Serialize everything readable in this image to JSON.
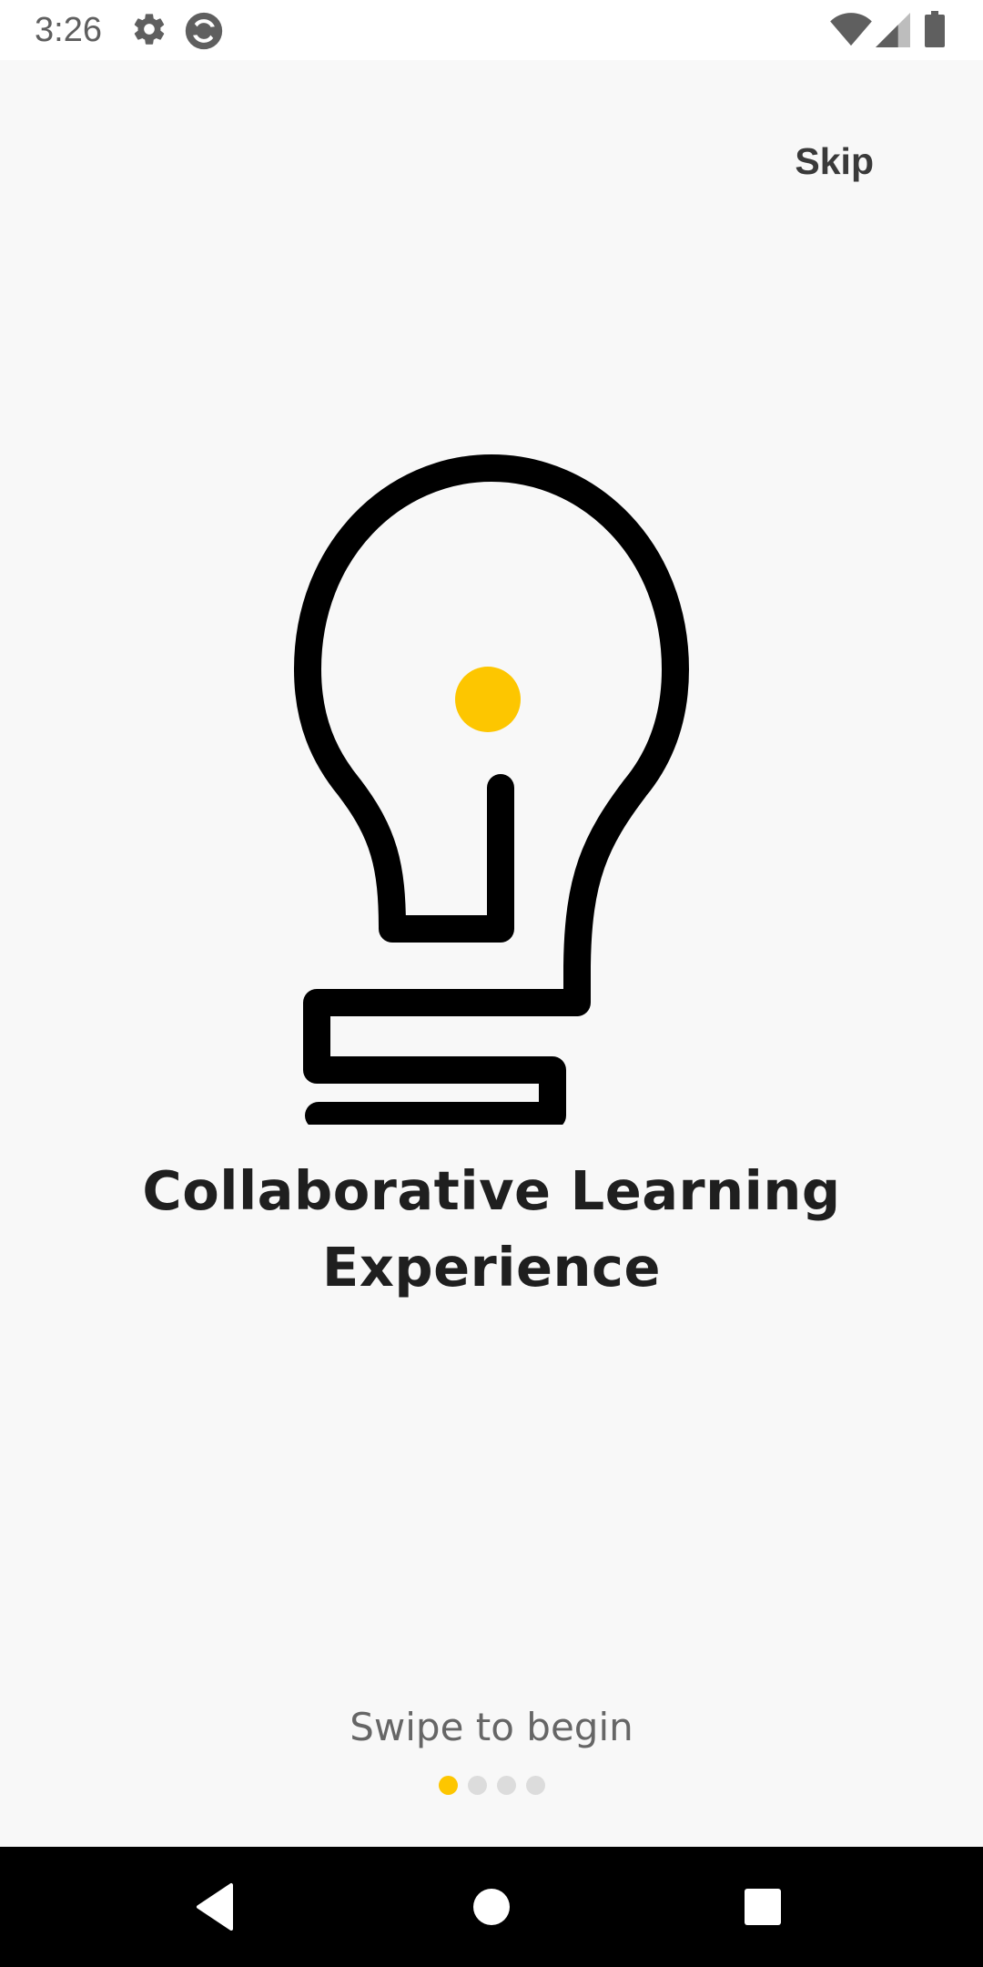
{
  "status_bar": {
    "time": "3:26",
    "icons": [
      "gear-icon",
      "sync-icon",
      "wifi-icon",
      "signal-icon",
      "battery-icon"
    ]
  },
  "onboarding": {
    "skip_label": "Skip",
    "headline": "Collaborative Learning Experience",
    "swipe_hint": "Swipe to begin",
    "page_indicator": {
      "current": 1,
      "total": 4
    },
    "accent_color": "#fdc600"
  },
  "navigation": {
    "buttons": [
      "back-icon",
      "home-icon",
      "recents-icon"
    ]
  }
}
